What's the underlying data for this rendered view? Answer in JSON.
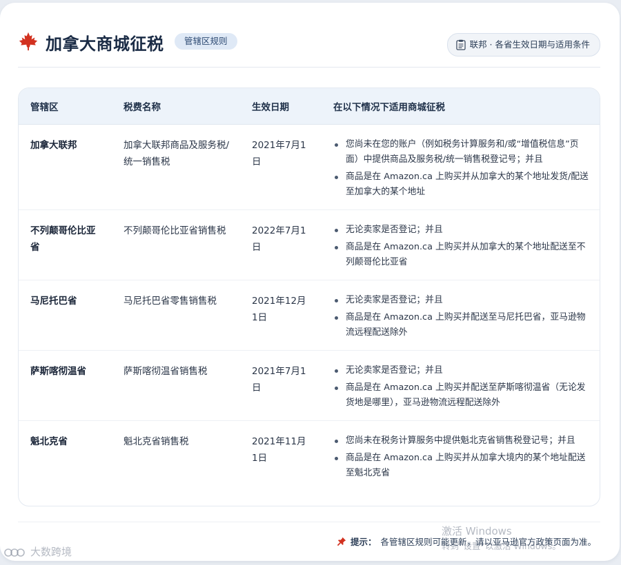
{
  "header": {
    "title": "加拿大商城征税",
    "badge": "管辖区规则",
    "right_button": "联邦 · 各省生效日期与适用条件",
    "leaf_icon": "maple-leaf-icon",
    "doc_icon": "clipboard-icon",
    "accent_color": "#c0392b"
  },
  "table": {
    "columns": [
      "管辖区",
      "税费名称",
      "生效日期",
      "在以下情况下适用商城征税"
    ],
    "rows": [
      {
        "jurisdiction": "加拿大联邦",
        "tax_name": "加拿大联邦商品及服务税/统一销售税",
        "effective_date": "2021年7月1日",
        "conditions": [
          "您尚未在您的账户（例如税务计算服务和/或“增值税信息”页面）中提供商品及服务税/统一销售税登记号；并且",
          "商品是在 Amazon.ca 上购买并从加拿大的某个地址发货/配送至加拿大的某个地址"
        ]
      },
      {
        "jurisdiction": "不列颠哥伦比亚省",
        "tax_name": "不列颠哥伦比亚省销售税",
        "effective_date": "2022年7月1日",
        "conditions": [
          "无论卖家是否登记；并且",
          "商品是在 Amazon.ca 上购买并从加拿大的某个地址配送至不列颠哥伦比亚省"
        ]
      },
      {
        "jurisdiction": "马尼托巴省",
        "tax_name": "马尼托巴省零售销售税",
        "effective_date": "2021年12月1日",
        "conditions": [
          "无论卖家是否登记；并且",
          "商品是在 Amazon.ca 上购买并配送至马尼托巴省，亚马逊物流远程配送除外"
        ]
      },
      {
        "jurisdiction": "萨斯喀彻温省",
        "tax_name": "萨斯喀彻温省销售税",
        "effective_date": "2021年7月1日",
        "conditions": [
          "无论卖家是否登记；并且",
          "商品是在 Amazon.ca 上购买并配送至萨斯喀彻温省（无论发货地是哪里），亚马逊物流远程配送除外"
        ]
      },
      {
        "jurisdiction": "魁北克省",
        "tax_name": "魁北克省销售税",
        "effective_date": "2021年11月1日",
        "conditions": [
          "您尚未在税务计算服务中提供魁北克省销售税登记号；并且",
          "商品是在 Amazon.ca 上购买并从加拿大境内的某个地址配送至魁北克省"
        ]
      }
    ]
  },
  "footer": {
    "tip_label": "提示：",
    "tip_text": "各管辖区规则可能更新，请以亚马逊官方政策页面为准。",
    "pin_icon": "pushpin-icon"
  },
  "overlays": {
    "windows_line1": "激活 Windows",
    "windows_line2": "转到“设置”以激活 Windows。",
    "logo_text": "大数跨境"
  }
}
